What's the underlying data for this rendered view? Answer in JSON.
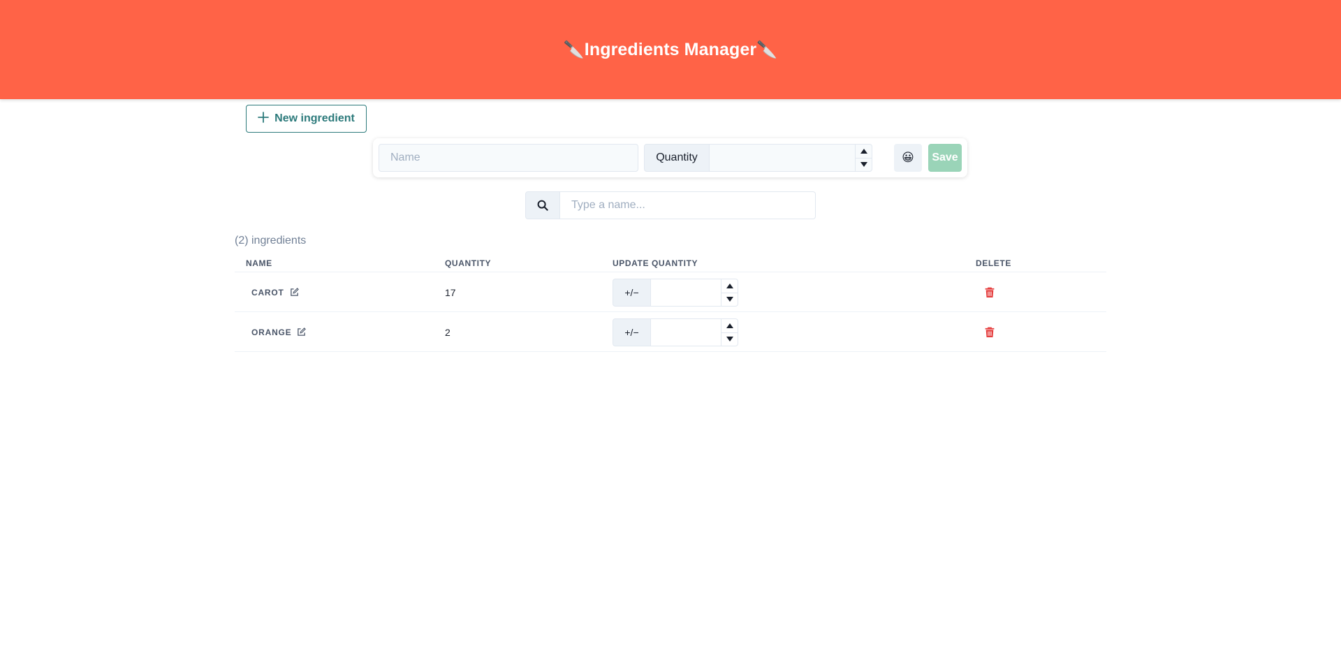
{
  "header": {
    "title": "Ingredients Manager",
    "knife_glyph": "🔪"
  },
  "new_ingredient": {
    "label": "New ingredient"
  },
  "form": {
    "name_placeholder": "Name",
    "quantity_label": "Quantity",
    "emoji": "😀",
    "save_label": "Save"
  },
  "search": {
    "placeholder": "Type a name..."
  },
  "list": {
    "count_text": "(2) ingredients",
    "columns": [
      "NAME",
      "QUANTITY",
      "UPDATE QUANTITY",
      "DELETE"
    ],
    "update_addon": "+/−",
    "rows": [
      {
        "name": "CAROT",
        "quantity": "17"
      },
      {
        "name": "ORANGE",
        "quantity": "2"
      }
    ]
  },
  "colors": {
    "header_bg": "#ff6347",
    "accent": "#2c7a7b",
    "save_bg": "#9ad4b8",
    "delete": "#e53e3e"
  }
}
